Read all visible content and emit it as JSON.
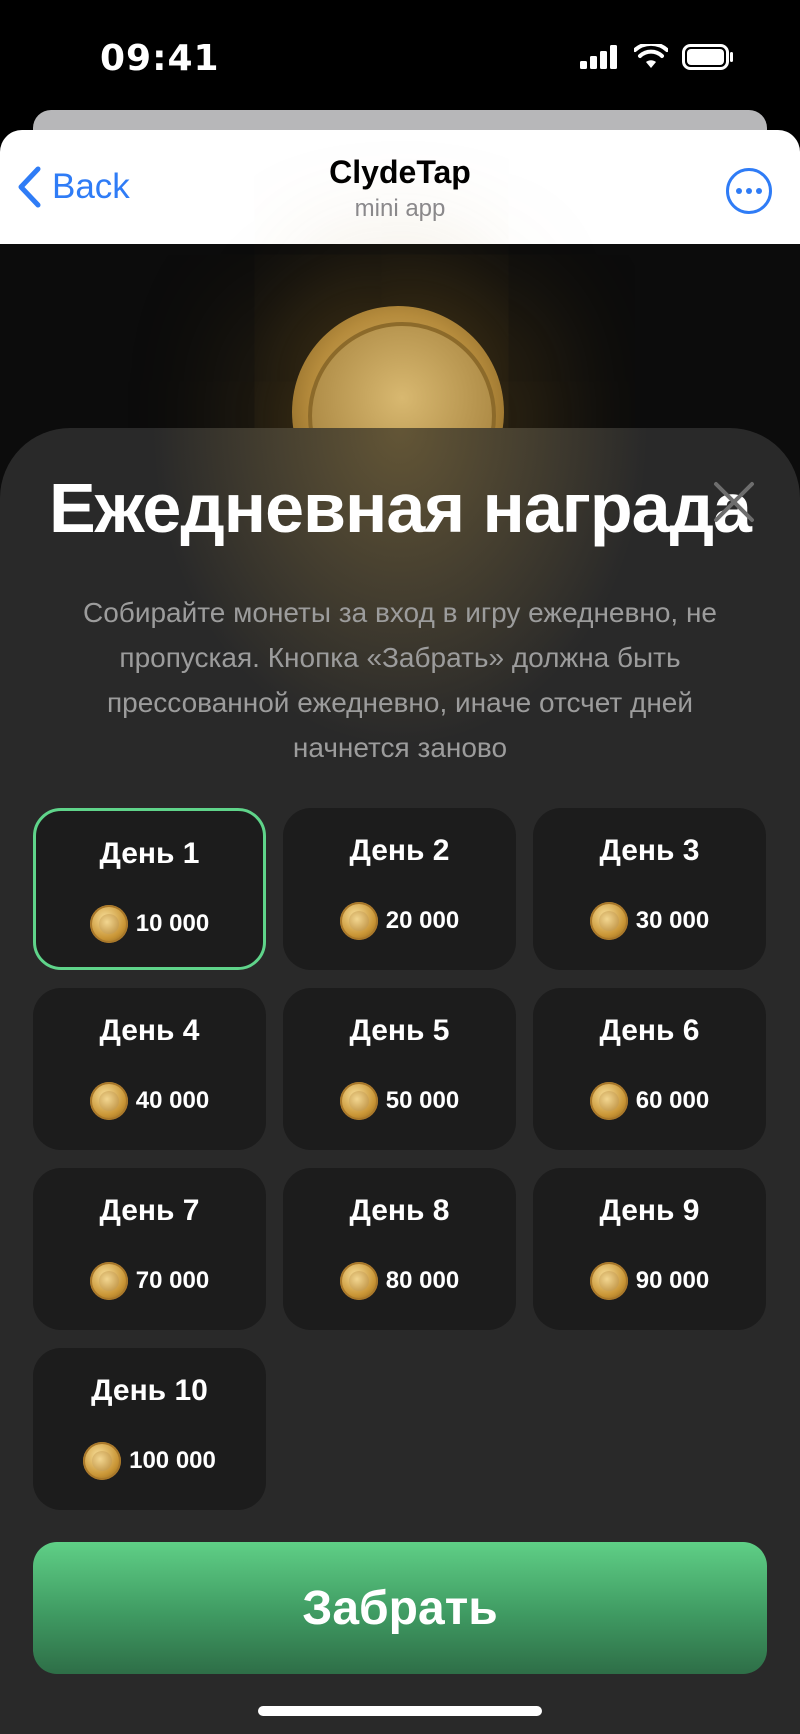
{
  "status": {
    "time": "09:41"
  },
  "header": {
    "back_label": "Back",
    "title": "ClydeTap",
    "subtitle": "mini app"
  },
  "modal": {
    "title": "Ежедневная награда",
    "description": "Собирайте монеты за вход в игру ежедневно, не пропуская. Кнопка «Забрать» должна быть прессованной ежедневно, иначе отсчет дней начнется заново",
    "days": [
      {
        "label": "День 1",
        "amount": "10 000",
        "active": true
      },
      {
        "label": "День 2",
        "amount": "20 000"
      },
      {
        "label": "День 3",
        "amount": "30 000"
      },
      {
        "label": "День 4",
        "amount": "40 000"
      },
      {
        "label": "День 5",
        "amount": "50 000"
      },
      {
        "label": "День 6",
        "amount": "60 000"
      },
      {
        "label": "День 7",
        "amount": "70 000"
      },
      {
        "label": "День 8",
        "amount": "80 000"
      },
      {
        "label": "День 9",
        "amount": "90 000"
      },
      {
        "label": "День 10",
        "amount": "100 000"
      }
    ],
    "claim_label": "Забрать"
  },
  "colors": {
    "accent_blue": "#2f7cf6",
    "active_border": "#5fd48a",
    "claim_green": "#5fcf86"
  },
  "icons": {
    "back": "chevron-left-icon",
    "more": "ellipsis-circle-icon",
    "close": "close-icon",
    "coin": "dog-coin-icon"
  }
}
